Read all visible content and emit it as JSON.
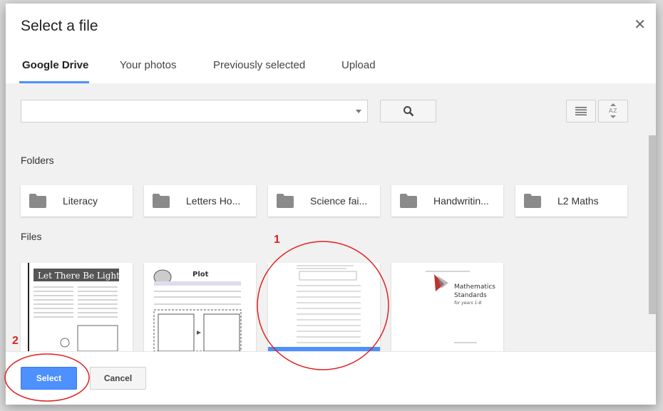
{
  "dialog": {
    "title": "Select a file",
    "close_icon": "close-icon"
  },
  "tabs": [
    {
      "label": "Google Drive",
      "active": true
    },
    {
      "label": "Your photos",
      "active": false
    },
    {
      "label": "Previously selected",
      "active": false
    },
    {
      "label": "Upload",
      "active": false
    }
  ],
  "toolbar": {
    "search_value": "",
    "search_icon": "search-icon",
    "list_view_icon": "list-view-icon",
    "sort_icon": "sort-az-icon"
  },
  "sections": {
    "folders_label": "Folders",
    "files_label": "Files"
  },
  "folders": [
    {
      "name": "Literacy"
    },
    {
      "name": "Letters Ho..."
    },
    {
      "name": "Science fai..."
    },
    {
      "name": "Handwritin..."
    },
    {
      "name": "L2 Maths"
    }
  ],
  "files": [
    {
      "title": "Let There Be Light",
      "selected": false
    },
    {
      "title": "Plot",
      "selected": false
    },
    {
      "title": "",
      "selected": true
    },
    {
      "title": "Mathematics Standards",
      "subtitle": "for years 1-8",
      "selected": false
    }
  ],
  "footer": {
    "select_label": "Select",
    "cancel_label": "Cancel"
  },
  "annotations": {
    "marker_1": "1",
    "marker_2": "2",
    "color": "#e02020"
  },
  "colors": {
    "accent": "#4d90fe",
    "body_bg": "#f1f1f1"
  }
}
